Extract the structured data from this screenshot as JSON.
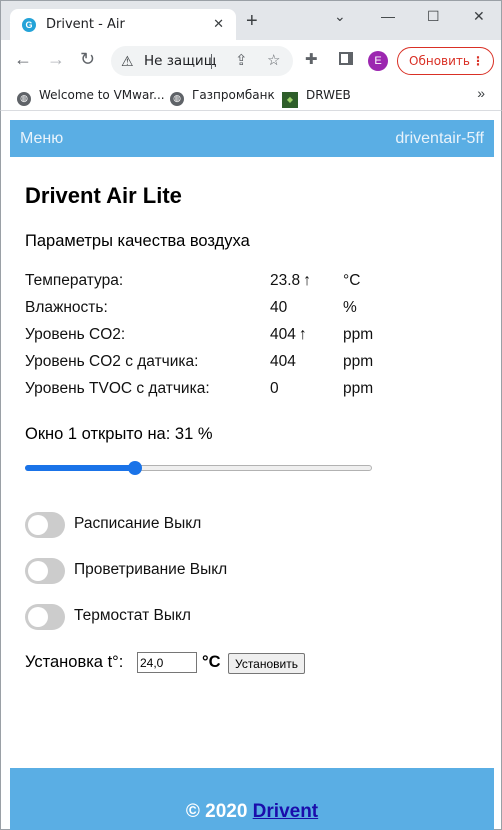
{
  "browser": {
    "tab_title": "Drivent - Air",
    "tab_favicon": "G",
    "omnibox_text": "Не защищ",
    "update_label": "Обновить",
    "profile_initial": "E",
    "bookmarks": [
      {
        "label": "Welcome to VMwar...",
        "icon": "globe-icon"
      },
      {
        "label": "Газпромбанк",
        "icon": "globe-icon"
      },
      {
        "label": "DRWEB",
        "icon": "drweb-icon"
      }
    ]
  },
  "navbar": {
    "menu_label": "Меню",
    "device_name": "driventair-5ff"
  },
  "main": {
    "title": "Drivent Air Lite",
    "subtitle": "Параметры качества воздуха",
    "params": [
      {
        "label": "Температура:",
        "value": "23.8",
        "arrow": "↑",
        "unit": "°C"
      },
      {
        "label": "Влажность:",
        "value": "40",
        "arrow": "",
        "unit": "%"
      },
      {
        "label": "Уровень CO2:",
        "value": "404",
        "arrow": "↑",
        "unit": "ppm"
      },
      {
        "label": "Уровень CO2 с датчика:",
        "value": "404",
        "arrow": "",
        "unit": "ppm"
      },
      {
        "label": "Уровень TVOC с датчика:",
        "value": "0",
        "arrow": "",
        "unit": "ppm"
      }
    ],
    "window_title": "Окно 1 открыто на: 31 %",
    "window_percent": 31,
    "toggles": [
      {
        "label": "Расписание Выкл",
        "on": false
      },
      {
        "label": "Проветривание Выкл",
        "on": false
      },
      {
        "label": "Термостат Выкл",
        "on": false
      }
    ],
    "setpoint": {
      "label": "Установка t°:",
      "value": "24,0",
      "unit": "°C",
      "button_label": "Установить"
    }
  },
  "footer": {
    "copyright": "© 2020",
    "link_label": "Drivent"
  },
  "colors": {
    "navbar": "#5aaee4",
    "slider": "#1a73e8",
    "toggle_off": "#cccccc"
  }
}
